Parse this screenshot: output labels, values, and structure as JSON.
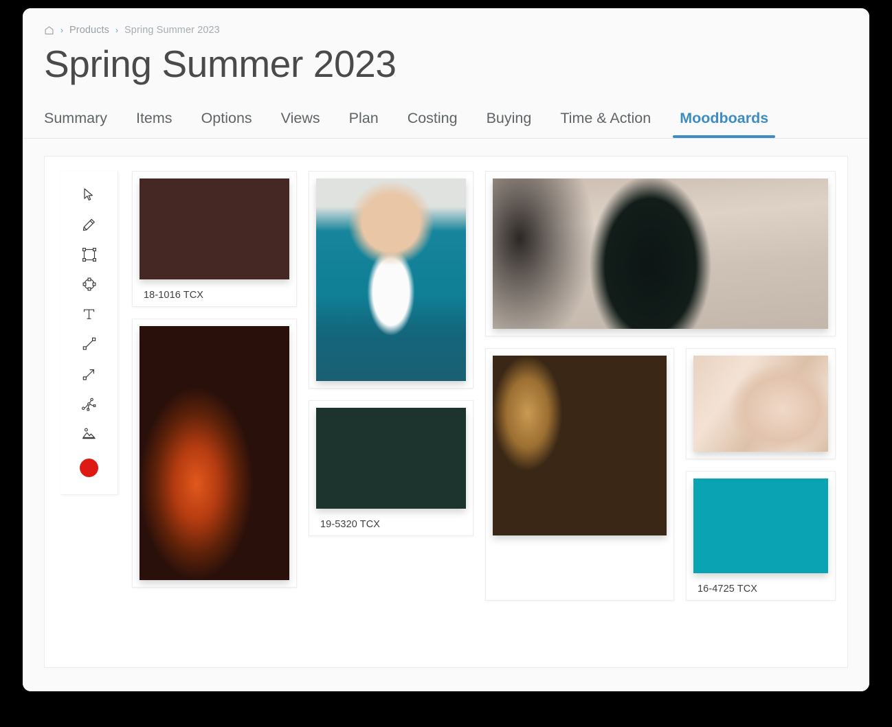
{
  "breadcrumb": {
    "home_icon": "home-icon",
    "separator": "›",
    "items": [
      {
        "label": "Products",
        "current": false
      },
      {
        "label": "Spring Summer 2023",
        "current": true
      }
    ]
  },
  "header": {
    "title": "Spring Summer 2023"
  },
  "tabs": [
    {
      "label": "Summary",
      "active": false
    },
    {
      "label": "Items",
      "active": false
    },
    {
      "label": "Options",
      "active": false
    },
    {
      "label": "Views",
      "active": false
    },
    {
      "label": "Plan",
      "active": false
    },
    {
      "label": "Costing",
      "active": false
    },
    {
      "label": "Buying",
      "active": false
    },
    {
      "label": "Time & Action",
      "active": false
    },
    {
      "label": "Moodboards",
      "active": true
    }
  ],
  "active_tab": "Moodboards",
  "toolbar": {
    "tools": [
      {
        "name": "select-tool",
        "icon": "cursor-arrow-icon"
      },
      {
        "name": "pencil-tool",
        "icon": "pencil-icon"
      },
      {
        "name": "rectangle-tool",
        "icon": "rectangle-icon"
      },
      {
        "name": "ellipse-tool",
        "icon": "ellipse-icon"
      },
      {
        "name": "text-tool",
        "icon": "text-t-icon"
      },
      {
        "name": "line-tool",
        "icon": "line-icon"
      },
      {
        "name": "arrow-tool",
        "icon": "arrow-icon"
      },
      {
        "name": "curve-tool",
        "icon": "bezier-curve-icon"
      },
      {
        "name": "image-tool",
        "icon": "image-mountain-icon"
      }
    ],
    "color_swatch": {
      "name": "color-swatch",
      "color": "#de1a15"
    }
  },
  "moodboard": {
    "cards": [
      {
        "id": "maroon-swatch",
        "type": "color",
        "label": "18-1016 TCX",
        "color": "#452724"
      },
      {
        "id": "leaves-photo",
        "type": "image",
        "label": null,
        "alt": "autumn-leaves-photo"
      },
      {
        "id": "jacket-photo",
        "type": "image",
        "label": null,
        "alt": "teal-denim-jacket-photo"
      },
      {
        "id": "green-swatch",
        "type": "color",
        "label": "19-5320 TCX",
        "color": "#1d332e"
      },
      {
        "id": "woman-photo",
        "type": "image",
        "label": null,
        "alt": "woman-in-black-dress-street-photo"
      },
      {
        "id": "logs-photo",
        "type": "image",
        "label": null,
        "alt": "stacked-cut-logs-photo"
      },
      {
        "id": "fabric-photo",
        "type": "image",
        "label": null,
        "alt": "beige-knit-fabric-photo"
      },
      {
        "id": "teal-swatch",
        "type": "color",
        "label": "16-4725 TCX",
        "color": "#0aa3b3"
      }
    ]
  },
  "theme": {
    "accent": "#3d8dc4",
    "breadcrumb_chevron": "#5aa7c9",
    "title_color": "#4a4a4a",
    "tab_color": "#5f6467",
    "canvas_bg": "#ffffff",
    "shell_bg": "#fafafa",
    "page_bg": "#000000"
  }
}
